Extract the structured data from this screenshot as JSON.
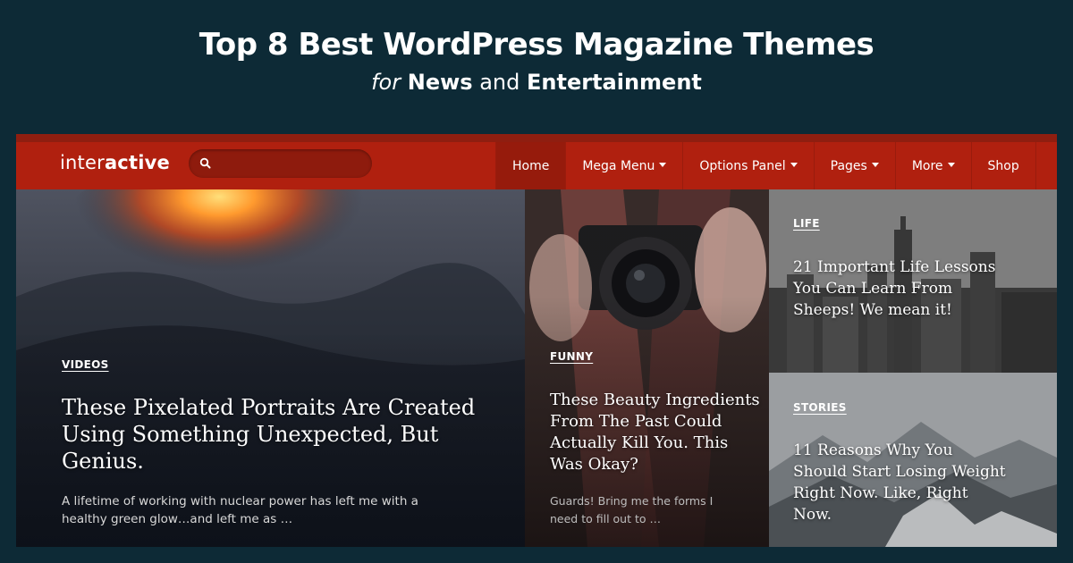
{
  "banner": {
    "title": "Top 8 Best WordPress Magazine Themes",
    "subtitle_for": "for",
    "subtitle_news": "News",
    "subtitle_and": "and",
    "subtitle_entertainment": "Entertainment"
  },
  "site": {
    "logo_light": "inter",
    "logo_bold": "active",
    "search": {
      "value": "",
      "placeholder": ""
    },
    "nav": [
      {
        "label": "Home",
        "active": true,
        "dropdown": false
      },
      {
        "label": "Mega Menu",
        "active": false,
        "dropdown": true
      },
      {
        "label": "Options Panel",
        "active": false,
        "dropdown": true
      },
      {
        "label": "Pages",
        "active": false,
        "dropdown": true
      },
      {
        "label": "More",
        "active": false,
        "dropdown": true
      },
      {
        "label": "Shop",
        "active": false,
        "dropdown": false
      }
    ],
    "brand_color": "#b0200f",
    "background_color": "#0d2a36"
  },
  "posts": [
    {
      "category": "VIDEOS",
      "title": "These Pixelated Portraits Are Created Using Something Unexpected, But Genius.",
      "excerpt": "A lifetime of working with nuclear power has left me with a healthy green glow…and left me as …"
    },
    {
      "category": "FUNNY",
      "title": "These Beauty Ingredients From The Past Could Actually Kill You. This Was Okay?",
      "excerpt": "Guards! Bring me the forms I need to fill out to …"
    },
    {
      "category": "LIFE",
      "title": "21 Important Life Lessons You Can Learn From Sheeps! We mean it!"
    },
    {
      "category": "STORIES",
      "title": "11 Reasons Why You Should Start Losing Weight Right Now. Like, Right Now."
    }
  ]
}
